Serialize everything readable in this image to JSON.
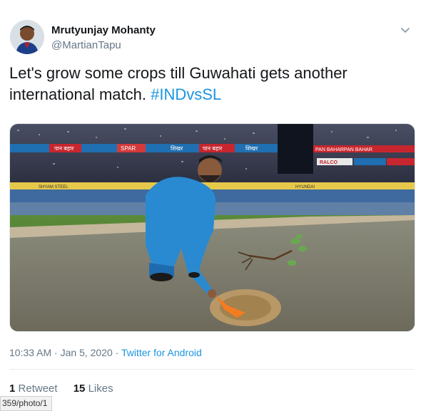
{
  "author": {
    "name": "Mrutyunjay Mohanty",
    "handle": "@MartianTapu"
  },
  "tweet": {
    "text_plain": "Let's grow some crops till Guwahati gets another international match.",
    "hashtag": "#INDvsSL"
  },
  "photo": {
    "banners": [
      "पान बहार",
      "SPAR",
      "शिखर",
      "पान बहार",
      "शिखर",
      "PAN BAHARPAN BAHAR",
      "RALCO",
      "SHYAM STEEL",
      "HYUNDAI"
    ]
  },
  "meta": {
    "time": "10:33 AM",
    "sep": " · ",
    "date": "Jan 5, 2020",
    "source": "Twitter for Android"
  },
  "stats": {
    "retweets_count": "1",
    "retweets_label": "Retweet",
    "likes_count": "15",
    "likes_label": "Likes"
  },
  "status_url": "359/photo/1"
}
